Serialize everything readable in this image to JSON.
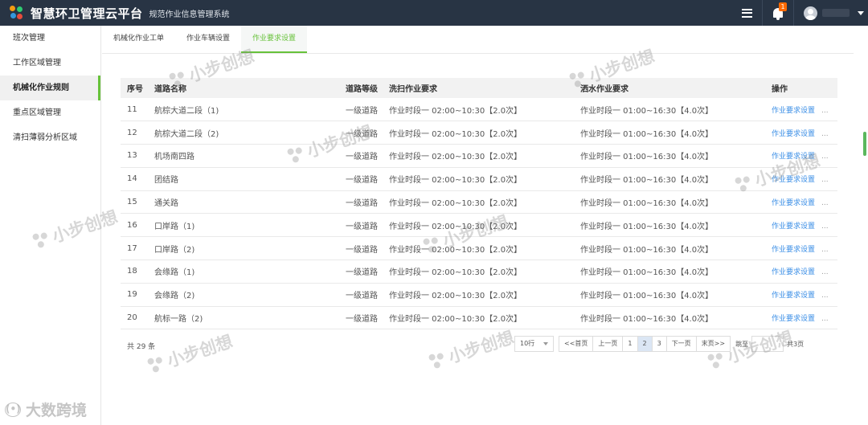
{
  "header": {
    "app_title": "智慧环卫管理云平台",
    "app_subtitle": "规范作业信息管理系统",
    "notification_count": "1"
  },
  "sidebar": {
    "items": [
      {
        "label": "班次管理"
      },
      {
        "label": "工作区域管理"
      },
      {
        "label": "机械化作业规则"
      },
      {
        "label": "重点区域管理"
      },
      {
        "label": "清扫薄弱分析区域"
      }
    ]
  },
  "tabs": [
    {
      "label": "机械化作业工单"
    },
    {
      "label": "作业车辆设置"
    },
    {
      "label": "作业要求设置"
    }
  ],
  "table": {
    "columns": [
      "序号",
      "道路名称",
      "道路等级",
      "洗扫作业要求",
      "洒水作业要求",
      "操作"
    ],
    "rows": [
      {
        "no": "11",
        "road": "航棕大道二段（1)",
        "level": "一级道路",
        "sweep": "作业时段一 02:00~10:30【2.0次】",
        "water": "作业时段一 01:00~16:30【4.0次】",
        "op": "作业要求设置",
        "more": "..."
      },
      {
        "no": "12",
        "road": "航棕大道二段（2)",
        "level": "一级道路",
        "sweep": "作业时段一 02:00~10:30【2.0次】",
        "water": "作业时段一 01:00~16:30【4.0次】",
        "op": "作业要求设置",
        "more": "..."
      },
      {
        "no": "13",
        "road": "机场南四路",
        "level": "一级道路",
        "sweep": "作业时段一 02:00~10:30【2.0次】",
        "water": "作业时段一 01:00~16:30【4.0次】",
        "op": "作业要求设置",
        "more": "..."
      },
      {
        "no": "14",
        "road": "团结路",
        "level": "一级道路",
        "sweep": "作业时段一 02:00~10:30【2.0次】",
        "water": "作业时段一 01:00~16:30【4.0次】",
        "op": "作业要求设置",
        "more": "..."
      },
      {
        "no": "15",
        "road": "通关路",
        "level": "一级道路",
        "sweep": "作业时段一 02:00~10:30【2.0次】",
        "water": "作业时段一 01:00~16:30【4.0次】",
        "op": "作业要求设置",
        "more": "..."
      },
      {
        "no": "16",
        "road": "口岸路（1)",
        "level": "一级道路",
        "sweep": "作业时段一 02:00~10:30【2.0次】",
        "water": "作业时段一 01:00~16:30【4.0次】",
        "op": "作业要求设置",
        "more": "..."
      },
      {
        "no": "17",
        "road": "口岸路（2)",
        "level": "一级道路",
        "sweep": "作业时段一 02:00~10:30【2.0次】",
        "water": "作业时段一 01:00~16:30【4.0次】",
        "op": "作业要求设置",
        "more": "..."
      },
      {
        "no": "18",
        "road": "会缘路（1)",
        "level": "一级道路",
        "sweep": "作业时段一 02:00~10:30【2.0次】",
        "water": "作业时段一 01:00~16:30【4.0次】",
        "op": "作业要求设置",
        "more": "..."
      },
      {
        "no": "19",
        "road": "会缘路（2)",
        "level": "一级道路",
        "sweep": "作业时段一 02:00~10:30【2.0次】",
        "water": "作业时段一 01:00~16:30【4.0次】",
        "op": "作业要求设置",
        "more": "..."
      },
      {
        "no": "20",
        "road": "航标一路（2)",
        "level": "一级道路",
        "sweep": "作业时段一 02:00~10:30【2.0次】",
        "water": "作业时段一 01:00~16:30【4.0次】",
        "op": "作业要求设置",
        "more": "..."
      }
    ]
  },
  "footer": {
    "total": "共 29 条",
    "page_size": "10行",
    "first": "<<首页",
    "prev": "上一页",
    "pages": [
      "1",
      "2",
      "3"
    ],
    "current_page": "2",
    "next": "下一页",
    "last": "末页>>",
    "goto": "跳至",
    "total_pages": "共3页"
  },
  "watermarks": [
    "小步创想",
    "小步创想",
    "小步创想",
    "小步创想",
    "小步创想",
    "小步创想",
    "小步创想",
    "小步创想",
    "小步创想"
  ],
  "brand_watermark": "大数跨境",
  "colors": {
    "header_bg": "#283444",
    "accent_green": "#67c23a",
    "link_blue": "#3a8ee6",
    "badge_orange": "#ff6a00"
  }
}
